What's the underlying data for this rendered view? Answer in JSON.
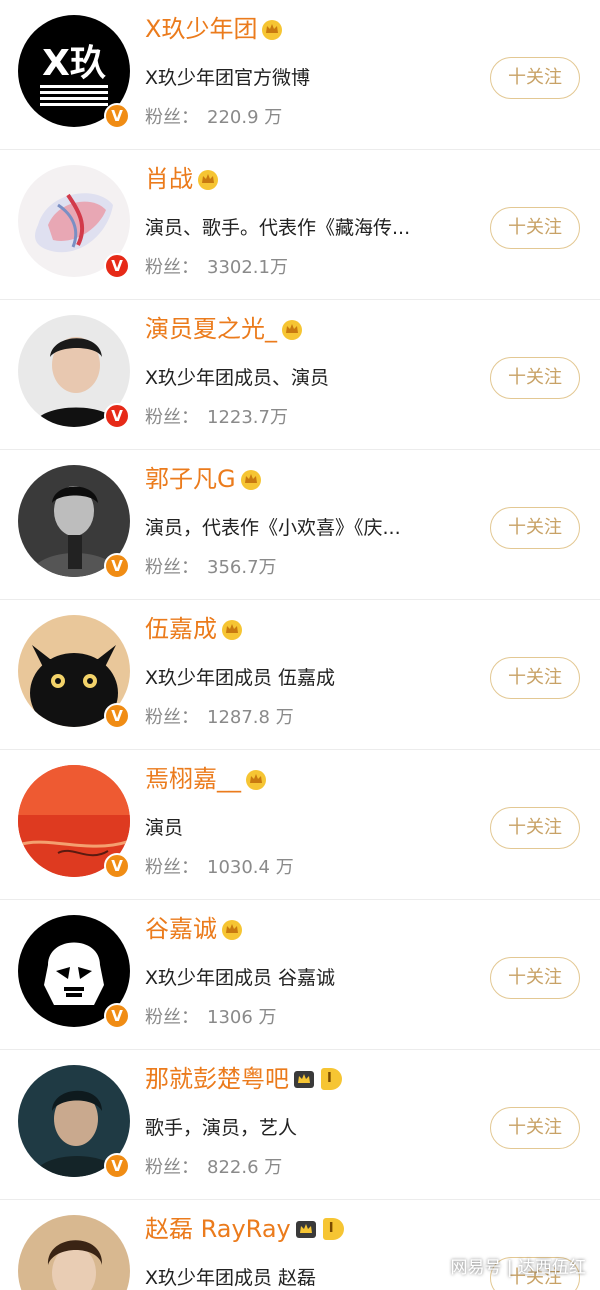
{
  "follow_label": "十关注",
  "fans_label": "粉丝：",
  "users": [
    {
      "name": "X玖少年团",
      "desc": "X玖少年团官方微博",
      "fans": "220.9 万",
      "level": null,
      "verify_color": "#f08c14"
    },
    {
      "name": "肖战",
      "desc": "演员、歌手。代表作《藏海传...",
      "fans": "3302.1万",
      "level": null,
      "verify_color": "#e62a18"
    },
    {
      "name": "演员夏之光_",
      "desc": "X玖少年团成员、演员",
      "fans": "1223.7万",
      "level": null,
      "verify_color": "#e62a18"
    },
    {
      "name": "郭子凡G",
      "desc": "演员，代表作《小欢喜》《庆...",
      "fans": "356.7万",
      "level": null,
      "verify_color": "#f08c14"
    },
    {
      "name": "伍嘉成",
      "desc": "X玖少年团成员 伍嘉成",
      "fans": "1287.8 万",
      "level": null,
      "verify_color": "#f08c14"
    },
    {
      "name": "焉栩嘉__",
      "desc": "演员",
      "fans": "1030.4 万",
      "level": null,
      "verify_color": "#f08c14"
    },
    {
      "name": "谷嘉诚",
      "desc": "X玖少年团成员 谷嘉诚",
      "fans": "1306 万",
      "level": null,
      "verify_color": "#f08c14"
    },
    {
      "name": "那就彭楚粤吧",
      "desc": "歌手，演员，艺人",
      "fans": "822.6 万",
      "level": "I",
      "verify_color": "#f08c14"
    },
    {
      "name": "赵磊 RayRay",
      "desc": "X玖少年团成员 赵磊",
      "fans": "",
      "level": "I",
      "verify_color": "#f08c14"
    }
  ],
  "watermark": "网易号 | 达西伍红"
}
